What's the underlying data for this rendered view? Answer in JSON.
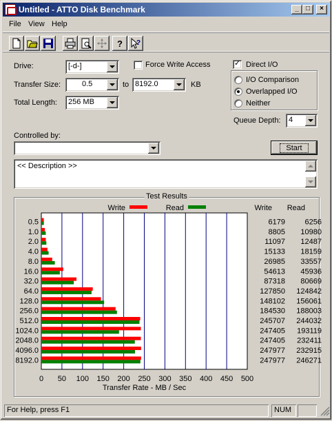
{
  "window": {
    "title": "Untitled - ATTO Disk Benchmark"
  },
  "title_buttons": {
    "minimize": "_",
    "maximize": "□",
    "close": "×"
  },
  "menu": [
    "File",
    "View",
    "Help"
  ],
  "toolbar_icons": [
    "new-file-icon",
    "open-folder-icon",
    "save-icon",
    "print-icon",
    "print-preview-icon",
    "move-icon",
    "help-icon",
    "context-help-icon"
  ],
  "form": {
    "drive_label": "Drive:",
    "drive_value": "[-d-]",
    "force_write_label": "Force Write Access",
    "force_write_checked": false,
    "direct_io_label": "Direct I/O",
    "direct_io_checked": true,
    "transfer_size_label": "Transfer Size:",
    "transfer_from": "0.5",
    "to_label": "to",
    "transfer_to": "8192.0",
    "kb_label": "KB",
    "total_length_label": "Total Length:",
    "total_length_value": "256 MB",
    "io_options": [
      "I/O Comparison",
      "Overlapped I/O",
      "Neither"
    ],
    "io_selected": 1,
    "queue_depth_label": "Queue Depth:",
    "queue_depth_value": "4",
    "controlled_by_label": "Controlled by:",
    "controlled_by_value": "",
    "start_label": "Start",
    "description_text": "<< Description >>"
  },
  "chart_data": {
    "type": "bar",
    "title": "Test Results",
    "xlabel": "Transfer Rate - MB / Sec",
    "xlim": [
      0,
      500
    ],
    "xticks": [
      "0",
      "50",
      "100",
      "150",
      "200",
      "250",
      "300",
      "350",
      "400",
      "450",
      "500"
    ],
    "legend": {
      "placement": "top",
      "write_label": "Write",
      "read_label": "Read"
    },
    "column_headers": {
      "write": "Write",
      "read": "Read"
    },
    "categories": [
      "0.5",
      "1.0",
      "2.0",
      "4.0",
      "8.0",
      "16.0",
      "32.0",
      "64.0",
      "128.0",
      "256.0",
      "512.0",
      "1024.0",
      "2048.0",
      "4096.0",
      "8192.0"
    ],
    "series": [
      {
        "name": "Write",
        "color": "#ff0000",
        "values": [
          6.0,
          8.6,
          10.8,
          14.8,
          26.4,
          53.3,
          85.3,
          124.9,
          144.7,
          180.2,
          240.0,
          241.6,
          241.6,
          242.2,
          242.2
        ]
      },
      {
        "name": "Read",
        "color": "#008000",
        "values": [
          6.1,
          10.7,
          12.2,
          17.7,
          32.8,
          44.9,
          78.8,
          121.9,
          152.4,
          183.6,
          238.3,
          188.7,
          227.0,
          227.5,
          240.5
        ]
      }
    ],
    "write_column": [
      "6179",
      "8805",
      "11097",
      "15133",
      "26985",
      "54613",
      "87318",
      "127850",
      "148102",
      "184530",
      "245707",
      "247405",
      "247405",
      "247977",
      "247977"
    ],
    "read_column": [
      "6256",
      "10980",
      "12487",
      "18159",
      "33557",
      "45936",
      "80669",
      "124842",
      "156061",
      "188003",
      "244032",
      "193119",
      "232411",
      "232915",
      "246271"
    ],
    "grid": true
  },
  "status": {
    "help_text": "For Help, press F1",
    "num": "NUM"
  }
}
